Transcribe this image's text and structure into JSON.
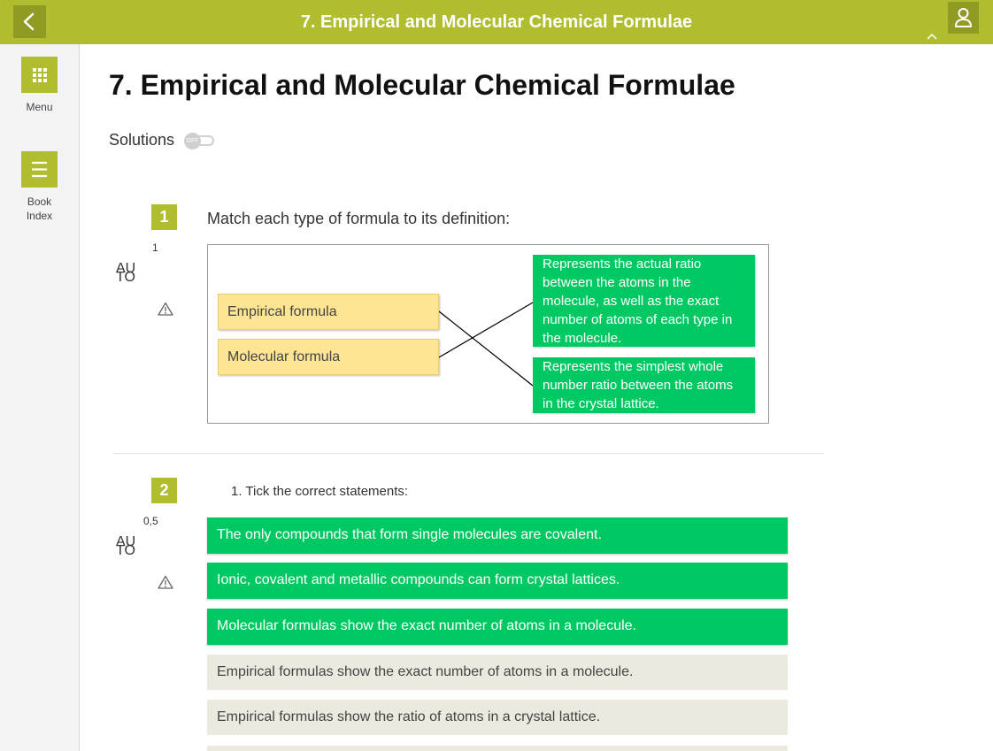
{
  "header": {
    "title": "7. Empirical and Molecular Chemical Formulae",
    "back_icon": "chevron-left-icon",
    "user_icon": "user-icon",
    "collapse_icon": "chevron-up-icon"
  },
  "sidebar": {
    "items": [
      {
        "label": "Menu",
        "icon": "grid-icon"
      },
      {
        "label_line1": "Book",
        "label_line2": "Index",
        "icon": "hamburger-icon"
      }
    ]
  },
  "page": {
    "title": "7. Empirical and Molecular Chemical Formulae",
    "solutions_label": "Solutions",
    "solutions_toggle": "OFF"
  },
  "questions": [
    {
      "number": "1",
      "score": "1",
      "auto_line1": "AU",
      "auto_line2": "TO",
      "prompt": "Match each type of formula to its definition:",
      "left": [
        "Empirical formula",
        "Molecular formula"
      ],
      "right": [
        "Represents the actual ratio between the atoms in the molecule, as well as the exact number of atoms of each type in the molecule.",
        "Represents the simplest whole number ratio between the atoms in the crystal lattice."
      ]
    },
    {
      "number": "2",
      "score": "0,5",
      "auto_line1": "AU",
      "auto_line2": "TO",
      "prompt": "1. Tick the correct statements:",
      "options": [
        {
          "text": "The only compounds that form single molecules are covalent.",
          "selected": true
        },
        {
          "text": "Ionic, covalent and metallic compounds can form crystal lattices.",
          "selected": true
        },
        {
          "text": "Molecular formulas show the exact number of atoms in a molecule.",
          "selected": true
        },
        {
          "text": "Empirical formulas show the exact number of atoms in a molecule.",
          "selected": false
        },
        {
          "text": "Empirical formulas show the ratio of atoms in a crystal lattice.",
          "selected": false
        }
      ]
    }
  ],
  "colors": {
    "accent": "#afbd2f",
    "accent_dark": "#8f9b23",
    "selected": "#00c862",
    "match_item": "#fde593",
    "unselected_option": "#ece9df"
  }
}
